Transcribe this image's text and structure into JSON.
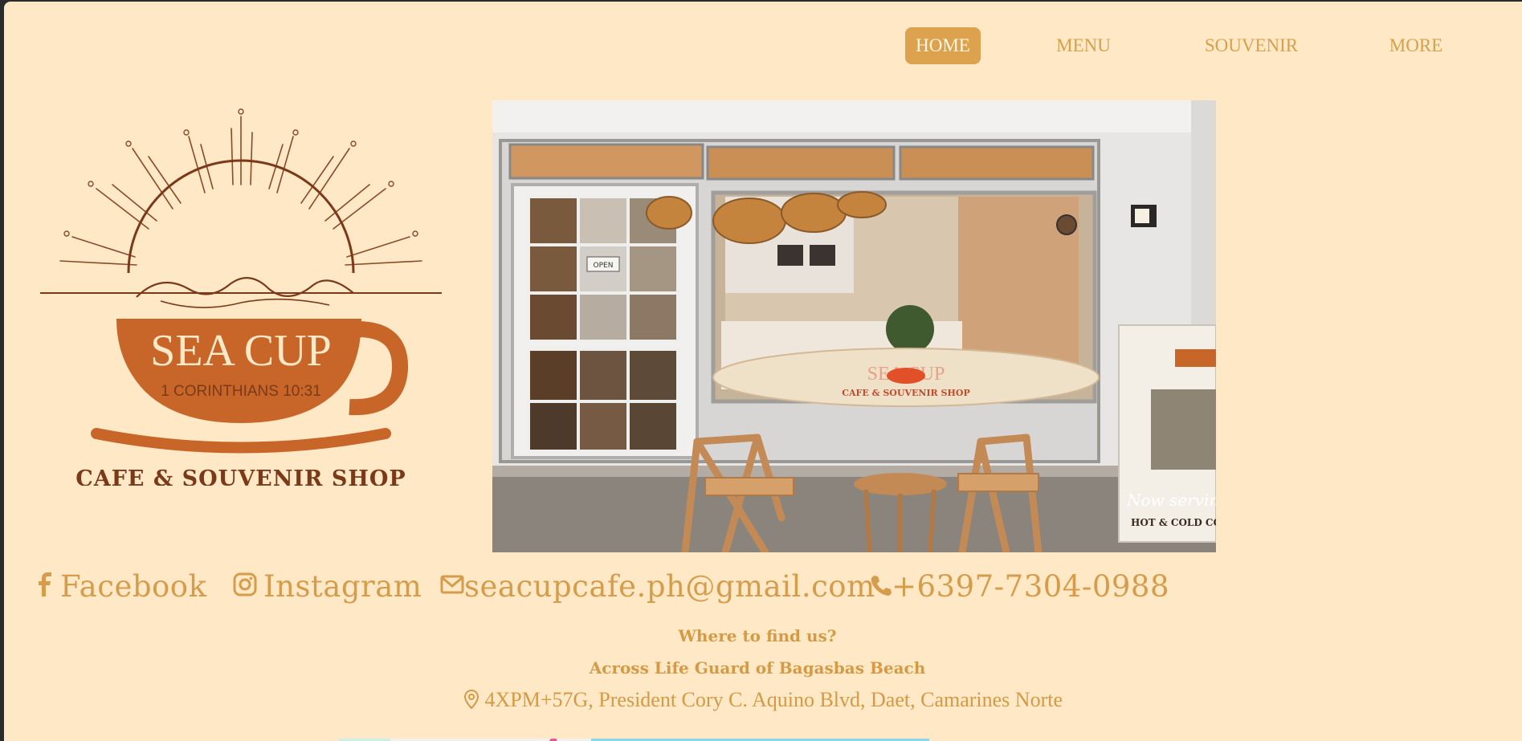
{
  "nav": {
    "items": [
      {
        "label": "HOME",
        "active": true
      },
      {
        "label": "MENU",
        "active": false
      },
      {
        "label": "SOUVENIR",
        "active": false
      },
      {
        "label": "MORE",
        "active": false
      }
    ]
  },
  "logo": {
    "title": "SEA CUP",
    "verse": "1 CORINTHIANS 10:31",
    "tagline": "CAFE & SOUVENIR SHOP"
  },
  "photo": {
    "sign_open": "OPEN",
    "surfboard_title": "SEA CUP",
    "surfboard_sub": "CAFE & SOUVENIR SHOP",
    "banner_text": "Now serving",
    "banner_sub": "HOT & COLD CO"
  },
  "contact": {
    "facebook": "Facebook",
    "instagram": "Instagram",
    "email": "seacupcafe.ph@gmail.com",
    "phone": "+6397-7304-0988"
  },
  "location": {
    "heading": "Where to find us?",
    "landmark": "Across Life Guard of Bagasbas Beach",
    "address": "4XPM+57G, President Cory C. Aquino Blvd, Daet, Camarines Norte"
  },
  "colors": {
    "background": "#fee8c5",
    "accent": "#dda24e",
    "brand_orange": "#c8662a",
    "logo_brown": "#7a3a1a"
  }
}
